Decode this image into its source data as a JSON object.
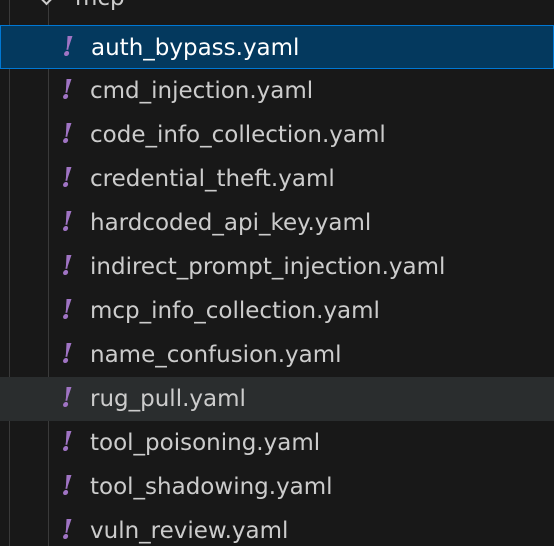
{
  "explorer": {
    "folder": {
      "label": "mcp",
      "expanded": true
    },
    "files": [
      {
        "label": "auth_bypass.yaml",
        "icon": "yaml-icon",
        "state": "selected"
      },
      {
        "label": "cmd_injection.yaml",
        "icon": "yaml-icon",
        "state": ""
      },
      {
        "label": "code_info_collection.yaml",
        "icon": "yaml-icon",
        "state": ""
      },
      {
        "label": "credential_theft.yaml",
        "icon": "yaml-icon",
        "state": ""
      },
      {
        "label": "hardcoded_api_key.yaml",
        "icon": "yaml-icon",
        "state": ""
      },
      {
        "label": "indirect_prompt_injection.yaml",
        "icon": "yaml-icon",
        "state": ""
      },
      {
        "label": "mcp_info_collection.yaml",
        "icon": "yaml-icon",
        "state": ""
      },
      {
        "label": "name_confusion.yaml",
        "icon": "yaml-icon",
        "state": ""
      },
      {
        "label": "rug_pull.yaml",
        "icon": "yaml-icon",
        "state": "hover"
      },
      {
        "label": "tool_poisoning.yaml",
        "icon": "yaml-icon",
        "state": ""
      },
      {
        "label": "tool_shadowing.yaml",
        "icon": "yaml-icon",
        "state": ""
      },
      {
        "label": "vuln_review.yaml",
        "icon": "yaml-icon",
        "state": ""
      }
    ],
    "icon_glyph": "!",
    "colors": {
      "background": "#181818",
      "selected_background": "#04395e",
      "selected_border": "#0078d4",
      "hover_background": "#2a2d2e",
      "yaml_icon": "#a074c4",
      "text": "#cccccc"
    }
  }
}
